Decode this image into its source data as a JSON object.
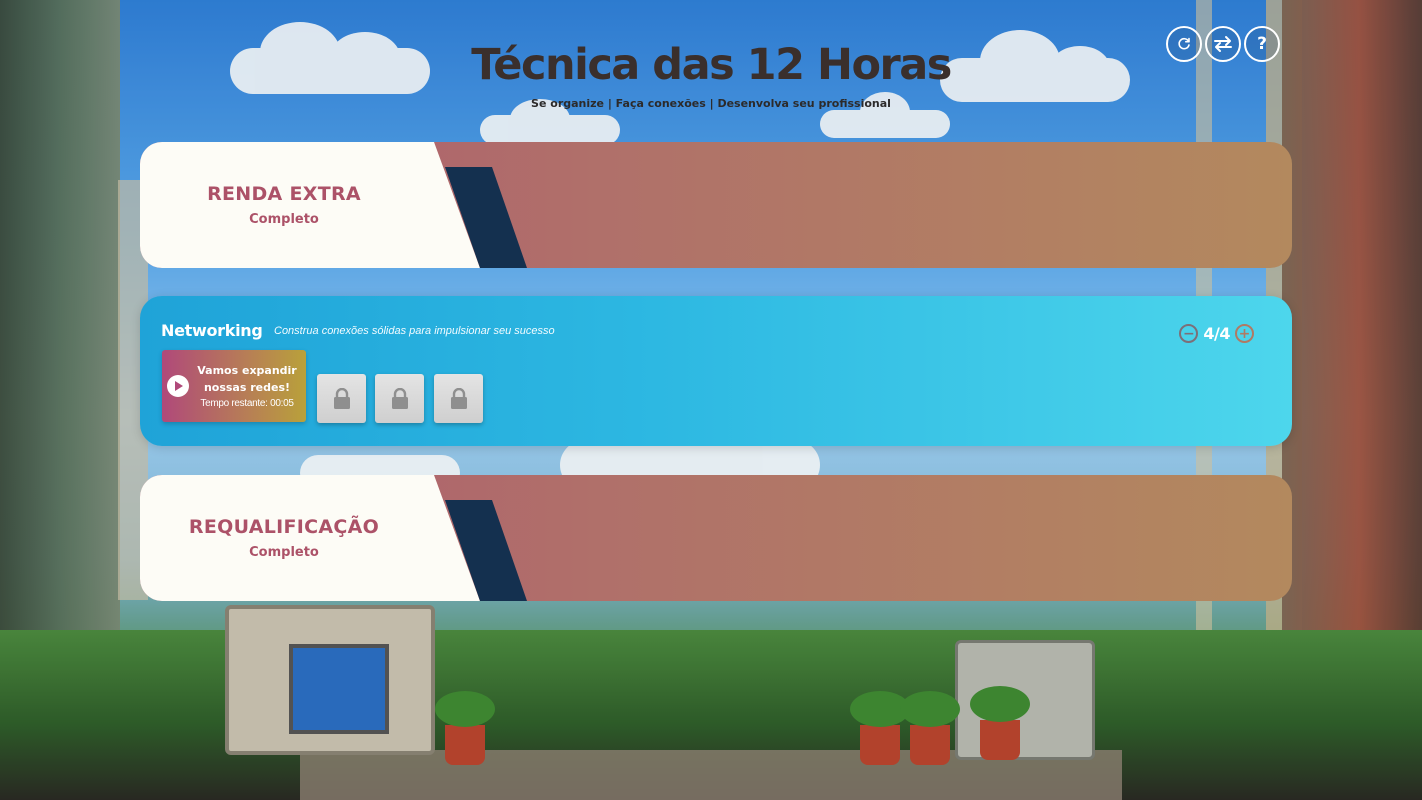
{
  "header": {
    "title": "Técnica das 12 Horas",
    "subtitle": "Se organize | Faça conexões | Desenvolva seu profissional"
  },
  "toolbar": {
    "buttons": [
      {
        "name": "refresh",
        "icon": "refresh-icon"
      },
      {
        "name": "swap",
        "icon": "swap-icon"
      },
      {
        "name": "help",
        "icon": "help-icon",
        "label": "?"
      }
    ]
  },
  "cards": {
    "renda_extra": {
      "name": "RENDA EXTRA",
      "status": "Completo"
    },
    "networking": {
      "title": "Networking",
      "description": "Construa conexões sólidas para impulsionar seu sucesso",
      "counter": "4/4",
      "minus": "−",
      "plus": "+",
      "active_task": {
        "message": "Vamos expandir nossas redes!",
        "timer": "Tempo restante: 00:05"
      },
      "locked_slots": 3
    },
    "requalificacao": {
      "name": "REQUALIFICAÇÃO",
      "status": "Completo"
    }
  },
  "colors": {
    "done_white": "#fdfcf6",
    "done_accent": "#ac5268",
    "done_stripe": "#14304f",
    "active_bg": "#2db8e2"
  }
}
